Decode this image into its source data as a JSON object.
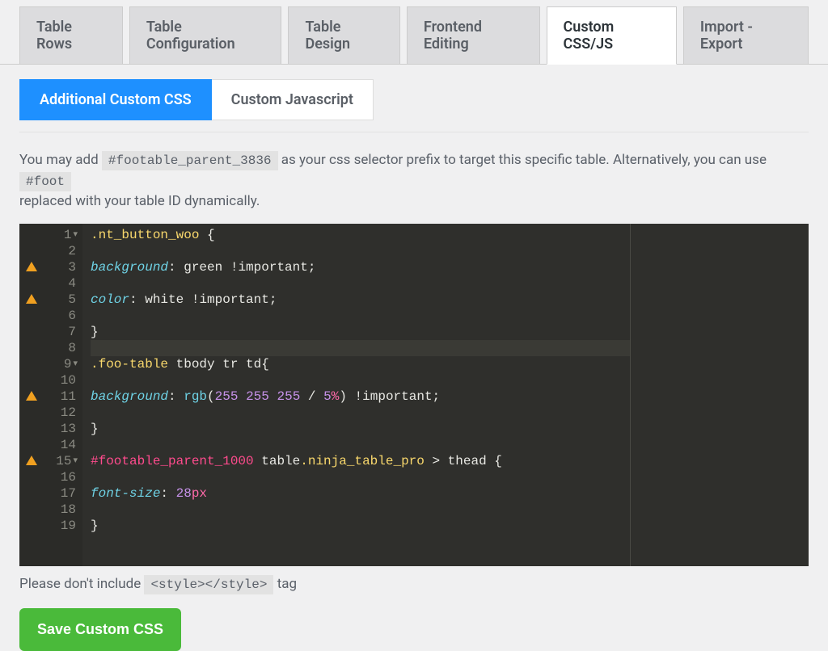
{
  "tabs_primary": [
    {
      "id": "rows",
      "label": "Table Rows"
    },
    {
      "id": "config",
      "label": "Table Configuration"
    },
    {
      "id": "design",
      "label": "Table Design"
    },
    {
      "id": "frontend",
      "label": "Frontend Editing"
    },
    {
      "id": "cssjs",
      "label": "Custom CSS/JS",
      "active": true
    },
    {
      "id": "impexp",
      "label": "Import - Export"
    }
  ],
  "tabs_secondary": [
    {
      "id": "addcss",
      "label": "Additional Custom CSS",
      "active": true
    },
    {
      "id": "customjs",
      "label": "Custom Javascript"
    }
  ],
  "help": {
    "pre": "You may add ",
    "code1": "#footable_parent_3836",
    "mid": " as your css selector prefix to target this specific table. Alternatively, you can use ",
    "code2": "#foot",
    "post": "replaced with your table ID dynamically."
  },
  "footer_hint": {
    "pre": "Please don't include ",
    "code": "<style></style>",
    "post": " tag"
  },
  "save_btn": "Save Custom CSS",
  "code_lines": [
    {
      "n": 1,
      "fold": true,
      "tokens": [
        {
          "t": ".nt_button_woo",
          "c": "c-sel"
        },
        {
          "t": " {",
          "c": "c-punc"
        }
      ]
    },
    {
      "n": 2,
      "tokens": []
    },
    {
      "n": 3,
      "warn": true,
      "tokens": [
        {
          "t": "background",
          "c": "c-prop"
        },
        {
          "t": ": ",
          "c": "c-punc"
        },
        {
          "t": "green",
          "c": "c-val"
        },
        {
          "t": " !important;",
          "c": "c-kw"
        }
      ]
    },
    {
      "n": 4,
      "tokens": []
    },
    {
      "n": 5,
      "warn": true,
      "tokens": [
        {
          "t": "color",
          "c": "c-prop"
        },
        {
          "t": ": ",
          "c": "c-punc"
        },
        {
          "t": "white",
          "c": "c-val"
        },
        {
          "t": " !important;",
          "c": "c-kw"
        }
      ]
    },
    {
      "n": 6,
      "tokens": []
    },
    {
      "n": 7,
      "tokens": [
        {
          "t": "}",
          "c": "c-punc"
        }
      ]
    },
    {
      "n": 8,
      "active": true,
      "tokens": []
    },
    {
      "n": 9,
      "fold": true,
      "tokens": [
        {
          "t": ".foo-table",
          "c": "c-sel"
        },
        {
          "t": " tbody tr td",
          "c": "c-tag"
        },
        {
          "t": "{",
          "c": "c-punc"
        }
      ]
    },
    {
      "n": 10,
      "tokens": []
    },
    {
      "n": 11,
      "warn": true,
      "tokens": [
        {
          "t": "background",
          "c": "c-prop"
        },
        {
          "t": ": ",
          "c": "c-punc"
        },
        {
          "t": "rgb",
          "c": "c-func"
        },
        {
          "t": "(",
          "c": "c-punc"
        },
        {
          "t": "255",
          "c": "c-num"
        },
        {
          "t": " ",
          "c": "c-punc"
        },
        {
          "t": "255",
          "c": "c-num"
        },
        {
          "t": " ",
          "c": "c-punc"
        },
        {
          "t": "255",
          "c": "c-num"
        },
        {
          "t": " / ",
          "c": "c-punc"
        },
        {
          "t": "5",
          "c": "c-num"
        },
        {
          "t": "%",
          "c": "c-unit"
        },
        {
          "t": ") !important;",
          "c": "c-kw"
        }
      ]
    },
    {
      "n": 12,
      "tokens": []
    },
    {
      "n": 13,
      "tokens": [
        {
          "t": "}",
          "c": "c-punc"
        }
      ]
    },
    {
      "n": 14,
      "tokens": []
    },
    {
      "n": 15,
      "warn": true,
      "fold": true,
      "tokens": [
        {
          "t": "#footable_parent_1000",
          "c": "c-selid"
        },
        {
          "t": " table",
          "c": "c-tag"
        },
        {
          "t": ".ninja_table_pro",
          "c": "c-sel"
        },
        {
          "t": " > thead ",
          "c": "c-tag"
        },
        {
          "t": "{",
          "c": "c-punc"
        }
      ]
    },
    {
      "n": 16,
      "tokens": []
    },
    {
      "n": 17,
      "tokens": [
        {
          "t": "font-size",
          "c": "c-prop"
        },
        {
          "t": ": ",
          "c": "c-punc"
        },
        {
          "t": "28",
          "c": "c-num"
        },
        {
          "t": "px",
          "c": "c-unit"
        }
      ]
    },
    {
      "n": 18,
      "tokens": []
    },
    {
      "n": 19,
      "tokens": [
        {
          "t": "}",
          "c": "c-punc"
        }
      ]
    }
  ]
}
